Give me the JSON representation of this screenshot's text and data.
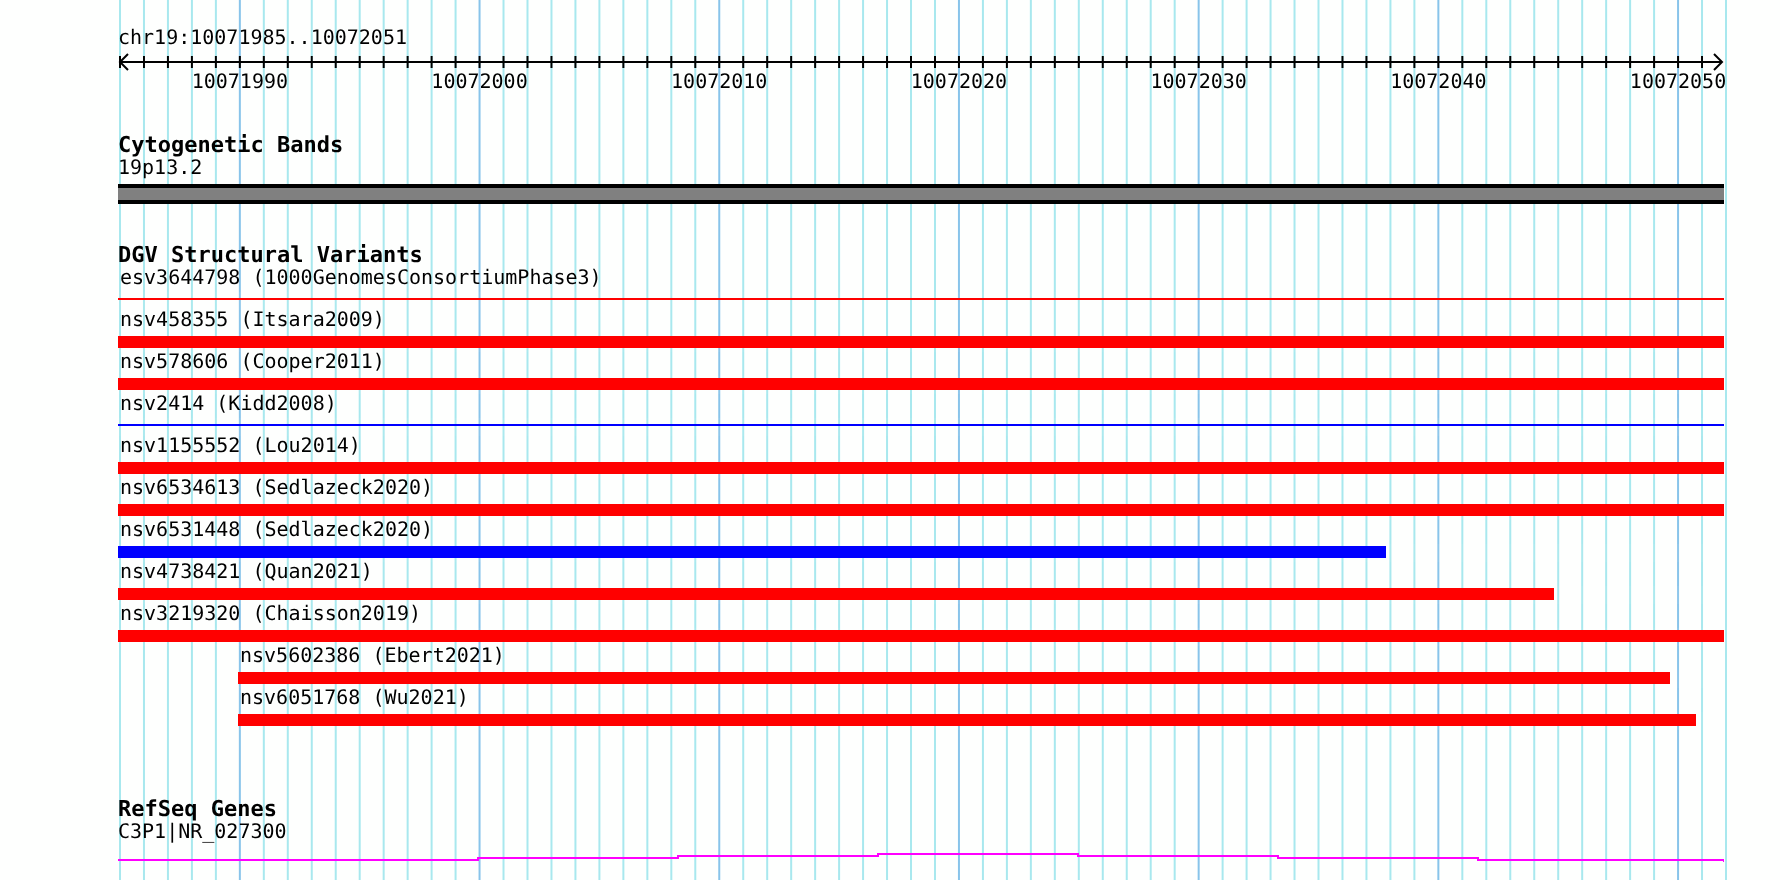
{
  "ruler": {
    "location": "chr19:10071985..10072051",
    "labels": [
      "10071990",
      "10072000",
      "10072010",
      "10072020",
      "10072030",
      "10072040",
      "10072050"
    ]
  },
  "cytogenetic_bands": {
    "title": "Cytogenetic Bands",
    "band": "19p13.2"
  },
  "dgv_structural_variants": {
    "title": "DGV Structural Variants",
    "features": [
      {
        "label": "esv3644798 (1000GenomesConsortiumPhase3)",
        "kind": "thin",
        "color": "#ff0000",
        "starts_in_view": false,
        "level": 1
      },
      {
        "label": "nsv458355 (Itsara2009)",
        "kind": "thick",
        "color": "#ff0000",
        "starts_in_view": false,
        "level": 1
      },
      {
        "label": "nsv578606 (Cooper2011)",
        "kind": "thick",
        "color": "#ff0000",
        "starts_in_view": false,
        "level": 1
      },
      {
        "label": "nsv2414 (Kidd2008)",
        "kind": "thin",
        "color": "#0000ff",
        "starts_in_view": false,
        "level": 1
      },
      {
        "label": "nsv1155552 (Lou2014)",
        "kind": "thick",
        "color": "#ff0000",
        "starts_in_view": false,
        "level": 1
      },
      {
        "label": "nsv6534613 (Sedlazeck2020)",
        "kind": "thick",
        "color": "#ff0000",
        "starts_in_view": false,
        "level": 1
      },
      {
        "label": "nsv6531448 (Sedlazeck2020)",
        "kind": "thick",
        "color": "#0000ff",
        "starts_in_view": false,
        "level": 0.79
      },
      {
        "label": "nsv4738421 (Quan2021)",
        "kind": "thick",
        "color": "#ff0000",
        "starts_in_view": false,
        "level": 0.894
      },
      {
        "label": "nsv3219320 (Chaisson2019)",
        "kind": "thick",
        "color": "#ff0000",
        "starts_in_view": false,
        "level": 1
      },
      {
        "label": "nsv5602386 (Ebert2021)",
        "kind": "thick",
        "color": "#ff0000",
        "starts_in_view": true,
        "level": 0.964
      },
      {
        "label": "nsv6051768 (Wu2021)",
        "kind": "thick",
        "color": "#ff0000",
        "starts_in_view": true,
        "level": 0.981
      }
    ]
  },
  "refseq_genes": {
    "title": "RefSeq Genes",
    "gene": "C3P1|NR_027300"
  }
}
